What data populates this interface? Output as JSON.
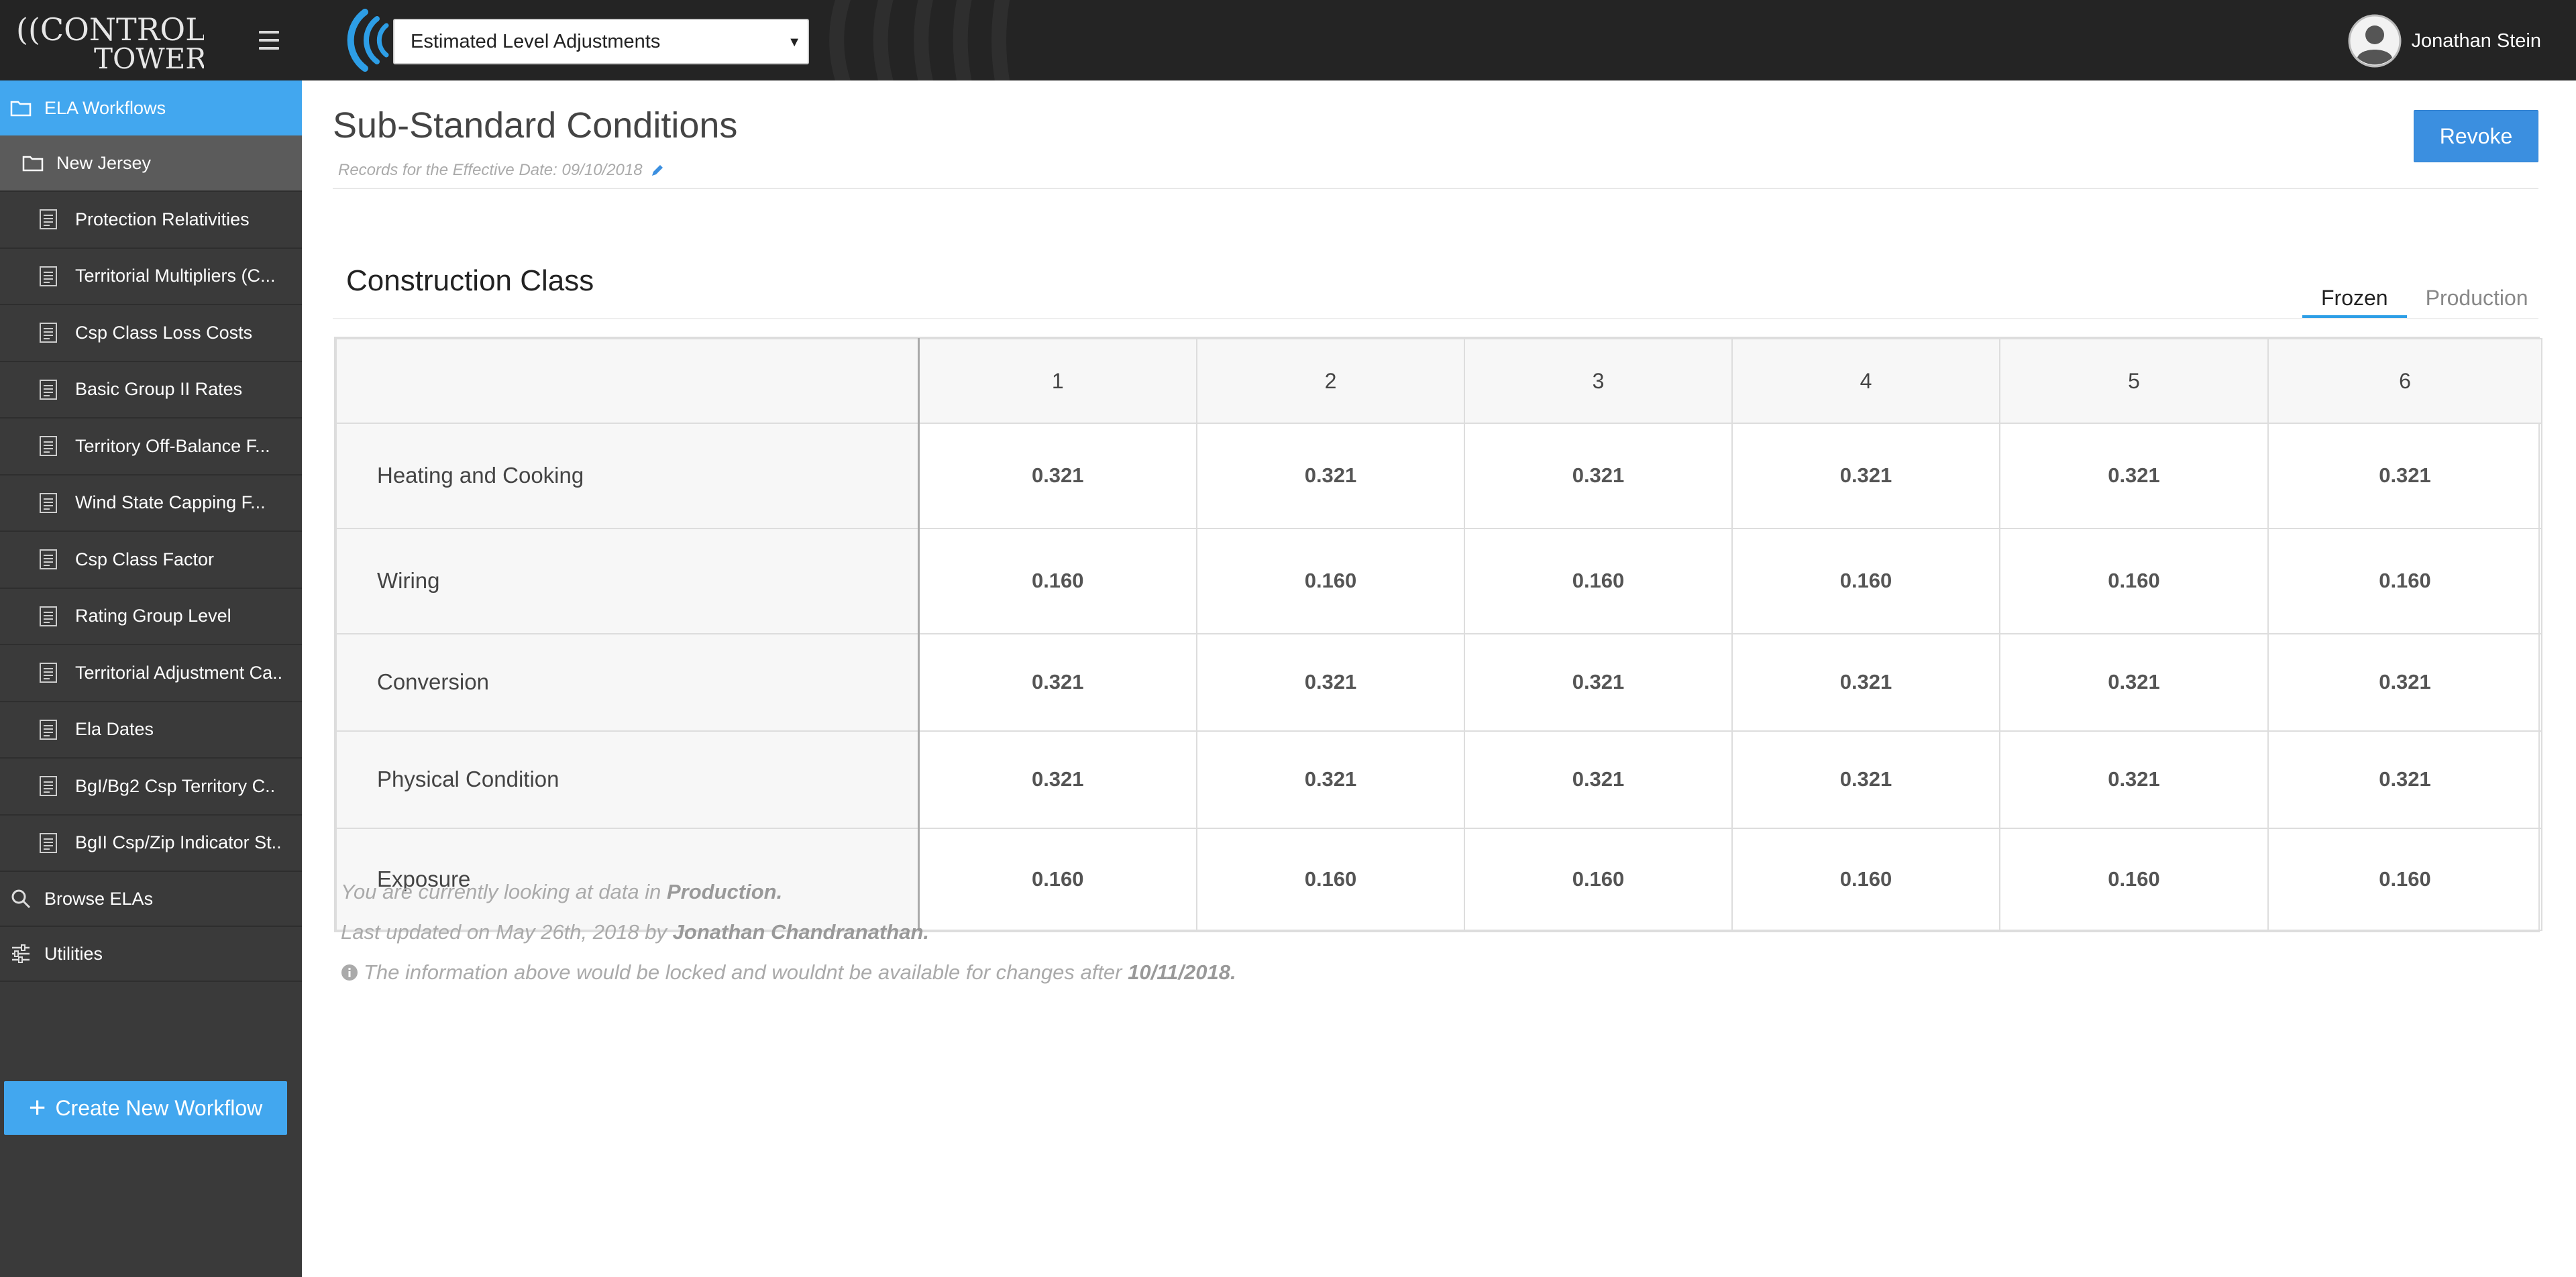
{
  "header": {
    "logo_line1": "((CONTROL",
    "logo_line2": "TOWER",
    "app_select": "Estimated Level Adjustments",
    "user_name": "Jonathan Stein"
  },
  "sidebar": {
    "workflows_label": "ELA Workflows",
    "folder_label": "New Jersey",
    "items": [
      {
        "label": "Protection Relativities"
      },
      {
        "label": "Territorial Multipliers (C..."
      },
      {
        "label": "Csp Class Loss Costs"
      },
      {
        "label": "Basic Group II Rates"
      },
      {
        "label": "Territory Off-Balance F..."
      },
      {
        "label": "Wind State Capping F..."
      },
      {
        "label": "Csp Class Factor"
      },
      {
        "label": "Rating Group Level"
      },
      {
        "label": "Territorial Adjustment Ca.."
      },
      {
        "label": "Ela Dates"
      },
      {
        "label": "BgI/Bg2 Csp Territory C.."
      },
      {
        "label": "BgII Csp/Zip Indicator St.."
      }
    ],
    "browse_label": "Browse ELAs",
    "utilities_label": "Utilities",
    "create_label": "Create New Workflow",
    "create_plus": "+"
  },
  "main": {
    "title": "Sub-Standard Conditions",
    "records_text": "Records for the Effective Date: 09/10/2018",
    "revoke_label": "Revoke",
    "section_title": "Construction Class",
    "tabs": [
      {
        "label": "Frozen",
        "active": true
      },
      {
        "label": "Production",
        "active": false
      }
    ]
  },
  "table": {
    "columns": [
      "1",
      "2",
      "3",
      "4",
      "5",
      "6"
    ],
    "rows": [
      {
        "label": "Heating and Cooking",
        "values": [
          "0.321",
          "0.321",
          "0.321",
          "0.321",
          "0.321",
          "0.321"
        ]
      },
      {
        "label": "Wiring",
        "values": [
          "0.160",
          "0.160",
          "0.160",
          "0.160",
          "0.160",
          "0.160"
        ]
      },
      {
        "label": "Conversion",
        "values": [
          "0.321",
          "0.321",
          "0.321",
          "0.321",
          "0.321",
          "0.321"
        ]
      },
      {
        "label": "Physical Condition",
        "values": [
          "0.321",
          "0.321",
          "0.321",
          "0.321",
          "0.321",
          "0.321"
        ]
      },
      {
        "label": "Exposure",
        "values": [
          "0.160",
          "0.160",
          "0.160",
          "0.160",
          "0.160",
          "0.160"
        ]
      }
    ]
  },
  "notes": {
    "line1_prefix": "You are currently looking at data in",
    "line1_bold": "Production.",
    "line2_prefix": "Last updated on May 26th, 2018 by",
    "line2_bold": "Jonathan Chandranathan.",
    "line3_prefix": "The information above would be locked and wouldnt be available for changes after",
    "line3_bold": "10/11/2018."
  },
  "colors": {
    "accent": "#42a7ef",
    "revoke": "#3b8fe0",
    "topbar": "#242424",
    "sidebar": "#3a3a3a"
  }
}
